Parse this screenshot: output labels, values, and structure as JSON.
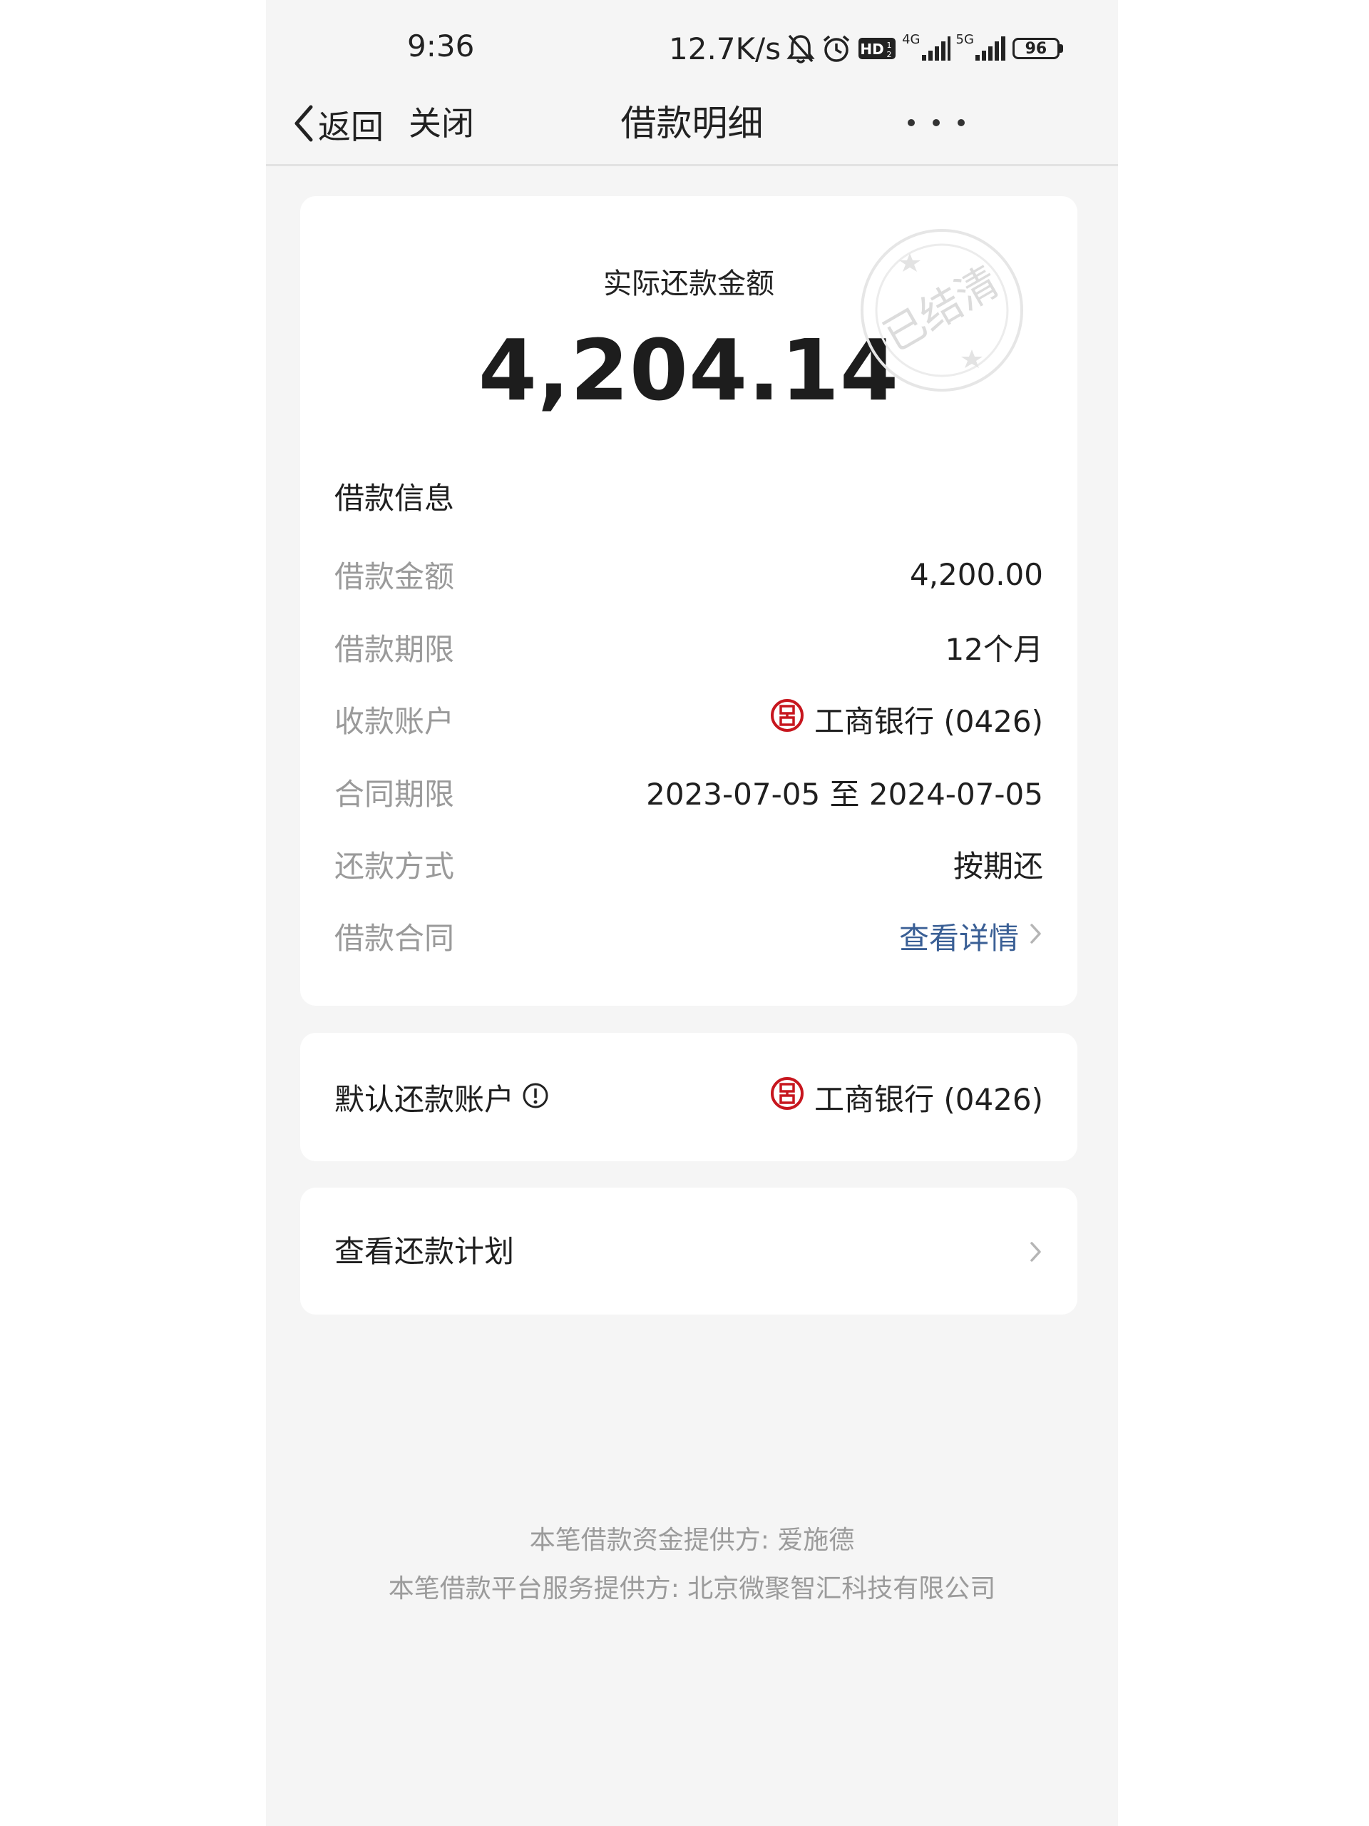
{
  "status_bar": {
    "time": "9:36",
    "net_speed": "12.7K/s",
    "network_1": "4G",
    "network_2": "5G",
    "battery": "96",
    "hd_badge": "HD"
  },
  "nav": {
    "back_label": "返回",
    "close_label": "关闭",
    "title": "借款明细"
  },
  "summary": {
    "amount_label": "实际还款金额",
    "amount_value": "4,204.14",
    "stamp_text": "已结清"
  },
  "loan_info": {
    "section_title": "借款信息",
    "rows": [
      {
        "label": "借款金额",
        "value": "4,200.00"
      },
      {
        "label": "借款期限",
        "value": "12个月"
      },
      {
        "label": "收款账户",
        "value": "工商银行 (0426)"
      },
      {
        "label": "合同期限",
        "value": "2023-07-05 至 2024-07-05"
      },
      {
        "label": "还款方式",
        "value": "按期还"
      },
      {
        "label": "借款合同",
        "value": "查看详情"
      }
    ]
  },
  "default_account": {
    "label": "默认还款账户",
    "value": "工商银行 (0426)"
  },
  "repay_plan": {
    "label": "查看还款计划"
  },
  "footer": {
    "line1": "本笔借款资金提供方: 爱施德",
    "line2": "本笔借款平台服务提供方: 北京微聚智汇科技有限公司"
  },
  "colors": {
    "background": "#f5f5f5",
    "card": "#ffffff",
    "link": "#3a5f95",
    "icbc_red": "#c7161e",
    "label_gray": "#9a9a9a"
  }
}
